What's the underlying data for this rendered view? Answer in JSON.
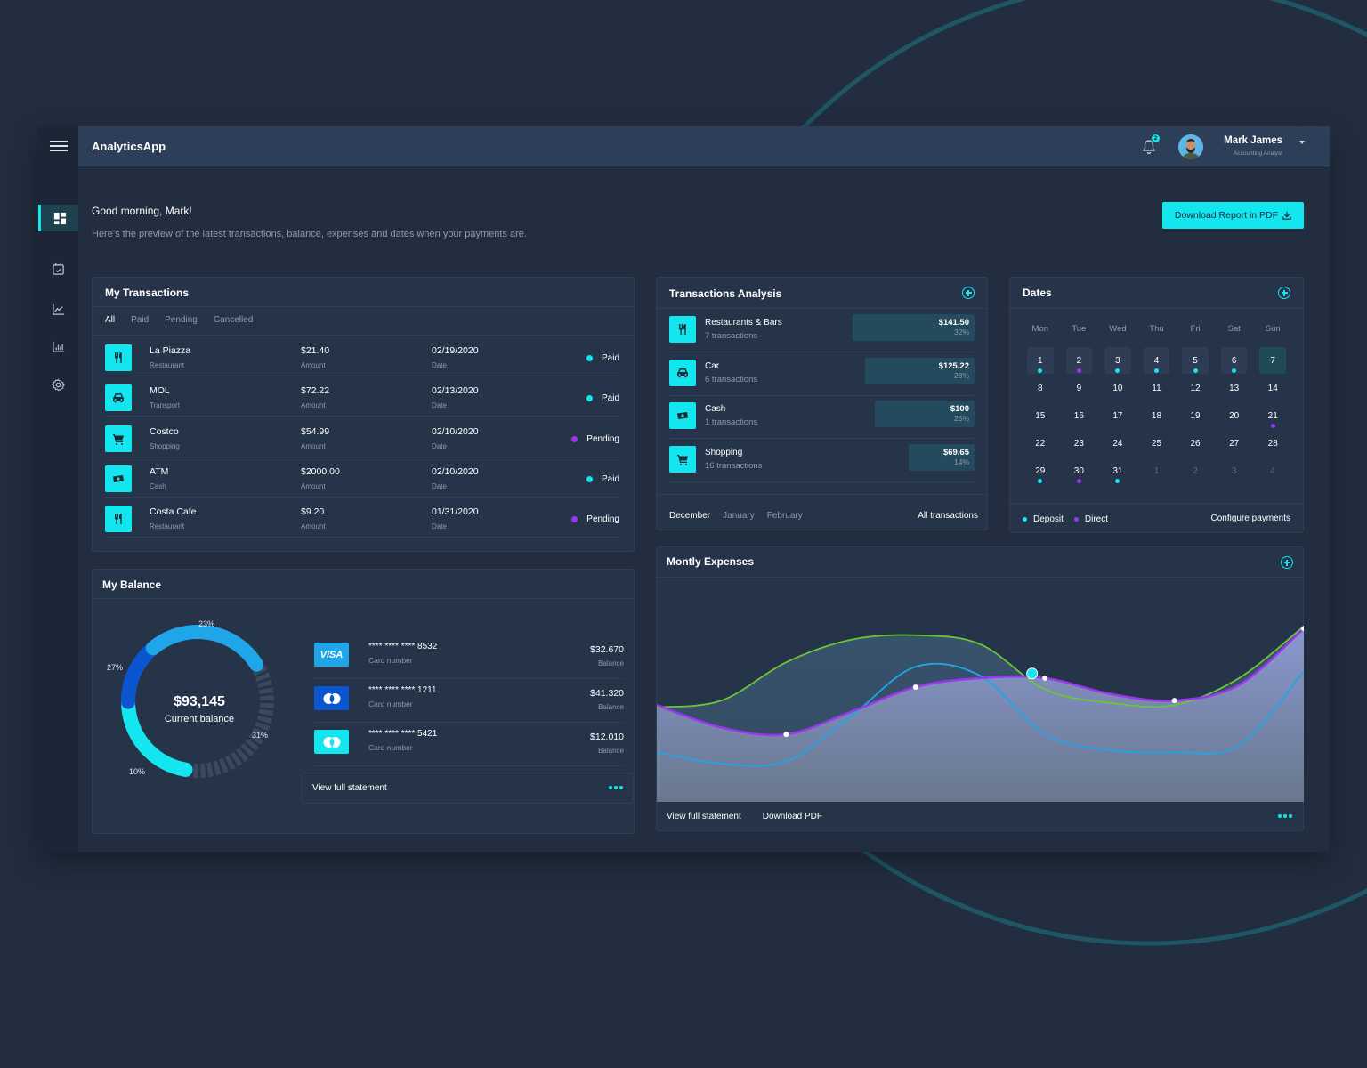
{
  "app": {
    "title": "AnalyticsApp",
    "notifications_count": "2",
    "user": {
      "name": "Mark James",
      "role": "Accounting Analyst"
    }
  },
  "sidebar": {
    "items": [
      {
        "icon": "dashboard-icon",
        "active": true
      },
      {
        "icon": "calendar-icon",
        "active": false
      },
      {
        "icon": "trend-chart-icon",
        "active": false
      },
      {
        "icon": "bar-chart-icon",
        "active": false
      },
      {
        "icon": "settings-icon",
        "active": false
      }
    ]
  },
  "header": {
    "greeting": "Good morning, Mark!",
    "subtitle": "Here’s the preview of the latest transactions, balance, expenses and dates when your payments are.",
    "download_label": "Download Report in PDF"
  },
  "transactions": {
    "title": "My Transactions",
    "tabs": [
      "All",
      "Paid",
      "Pending",
      "Cancelled"
    ],
    "active_tab": "All",
    "amount_label": "Amount",
    "date_label": "Date",
    "rows": [
      {
        "name": "La Piazza",
        "category": "Restaurant",
        "icon": "restaurant-icon",
        "amount": "$21.40",
        "date": "02/19/2020",
        "status": "Paid"
      },
      {
        "name": "MOL",
        "category": "Transport",
        "icon": "car-icon",
        "amount": "$72.22",
        "date": "02/13/2020",
        "status": "Paid"
      },
      {
        "name": "Costco",
        "category": "Shopping",
        "icon": "cart-icon",
        "amount": "$54.99",
        "date": "02/10/2020",
        "status": "Pending"
      },
      {
        "name": "ATM",
        "category": "Cash",
        "icon": "cash-icon",
        "amount": "$2000.00",
        "date": "02/10/2020",
        "status": "Paid"
      },
      {
        "name": "Costa Cafe",
        "category": "Restaurant",
        "icon": "restaurant-icon",
        "amount": "$9.20",
        "date": "01/31/2020",
        "status": "Pending"
      }
    ]
  },
  "analysis": {
    "title": "Transactions Analysis",
    "rows": [
      {
        "name": "Restaurants & Bars",
        "count": "7 transactions",
        "icon": "restaurant-icon",
        "value": "$141.50",
        "percent": "32%",
        "share": 0.32
      },
      {
        "name": "Car",
        "count": "6 transactions",
        "icon": "car-icon",
        "value": "$125.22",
        "percent": "28%",
        "share": 0.28
      },
      {
        "name": "Cash",
        "count": "1 transactions",
        "icon": "cash-icon",
        "value": "$100",
        "percent": "25%",
        "share": 0.25
      },
      {
        "name": "Shopping",
        "count": "16 transactions",
        "icon": "cart-icon",
        "value": "$69.65",
        "percent": "14%",
        "share": 0.14
      }
    ],
    "months": [
      "December",
      "January",
      "February"
    ],
    "active_month": "December",
    "all_link": "All transactions"
  },
  "dates": {
    "title": "Dates",
    "weekdays": [
      "Mon",
      "Tue",
      "Wed",
      "Thu",
      "Fri",
      "Sat",
      "Sun"
    ],
    "days": [
      {
        "n": "1",
        "ev": "deposit",
        "boxed": true
      },
      {
        "n": "2",
        "ev": "direct",
        "boxed": true
      },
      {
        "n": "3",
        "ev": "deposit",
        "boxed": true
      },
      {
        "n": "4",
        "ev": "deposit",
        "boxed": true
      },
      {
        "n": "5",
        "ev": "deposit",
        "boxed": true
      },
      {
        "n": "6",
        "ev": "deposit",
        "boxed": true
      },
      {
        "n": "7",
        "today": true,
        "boxed": true
      },
      {
        "n": "8"
      },
      {
        "n": "9"
      },
      {
        "n": "10"
      },
      {
        "n": "11"
      },
      {
        "n": "12"
      },
      {
        "n": "13"
      },
      {
        "n": "14"
      },
      {
        "n": "15"
      },
      {
        "n": "16"
      },
      {
        "n": "17"
      },
      {
        "n": "18"
      },
      {
        "n": "19"
      },
      {
        "n": "20"
      },
      {
        "n": "21",
        "ev": "direct"
      },
      {
        "n": "22"
      },
      {
        "n": "23"
      },
      {
        "n": "24"
      },
      {
        "n": "25"
      },
      {
        "n": "26"
      },
      {
        "n": "27"
      },
      {
        "n": "28"
      },
      {
        "n": "29",
        "ev": "deposit"
      },
      {
        "n": "30",
        "ev": "direct"
      },
      {
        "n": "31",
        "ev": "deposit"
      },
      {
        "n": "1",
        "muted": true
      },
      {
        "n": "2",
        "muted": true
      },
      {
        "n": "3",
        "muted": true
      },
      {
        "n": "4",
        "muted": true
      }
    ],
    "legend": {
      "deposit": "Deposit",
      "direct": "Direct"
    },
    "configure_link": "Configure payments"
  },
  "balance": {
    "title": "My Balance",
    "total": "$93,145",
    "total_label": "Current balance",
    "segments": [
      {
        "label": "23%",
        "value": 23,
        "color": "#1ea6e8"
      },
      {
        "label": "27%",
        "value": 27,
        "color": "#0b56cf"
      },
      {
        "label": "10%",
        "value": 10,
        "color": "#13e6ef"
      },
      {
        "label": "31%",
        "value": 31,
        "color": "#3a4a5e"
      }
    ],
    "cards": [
      {
        "brand": "visa-icon",
        "brand_label": "VISA",
        "number": "**** **** **** 8532",
        "number_label": "Card number",
        "balance": "$32.670",
        "balance_label": "Balance",
        "color": "#1ea6e8"
      },
      {
        "brand": "mastercard-icon",
        "number": "**** **** **** 1211",
        "number_label": "Card number",
        "balance": "$41.320",
        "balance_label": "Balance",
        "color": "#0b56cf"
      },
      {
        "brand": "mastercard-icon",
        "number": "**** **** **** 5421",
        "number_label": "Card number",
        "balance": "$12.010",
        "balance_label": "Balance",
        "color": "#13e6ef"
      }
    ],
    "statement_link": "View full statement"
  },
  "expenses": {
    "title": "Montly Expenses",
    "view_link": "View full statement",
    "pdf_link": "Download PDF"
  },
  "colors": {
    "accent": "#13e6ef",
    "paid": "#13e6ef",
    "pending": "#9b36f0",
    "deposit": "#13e6ef",
    "direct": "#9b36f0"
  },
  "chart_data": {
    "type": "area",
    "title": "Montly Expenses",
    "x": [
      0,
      1,
      2,
      3,
      4,
      5,
      6,
      7,
      8,
      9,
      10
    ],
    "series": [
      {
        "name": "green-series",
        "color": "#6cc43a",
        "values": [
          42,
          45,
          62,
          72,
          74,
          70,
          50,
          44,
          43,
          55,
          78
        ]
      },
      {
        "name": "blue-series",
        "color": "#1ea6e8",
        "values": [
          22,
          17,
          18,
          38,
          60,
          56,
          30,
          23,
          22,
          25,
          58
        ]
      },
      {
        "name": "purple-series",
        "color": "#9b36f0",
        "values": [
          43,
          33,
          30,
          40,
          51,
          55,
          55,
          48,
          45,
          52,
          77
        ]
      }
    ],
    "highlight": {
      "series": "blue-series",
      "x": 5.8,
      "value": 57
    },
    "ylim": [
      0,
      100
    ],
    "grid": false,
    "legend": "none"
  }
}
